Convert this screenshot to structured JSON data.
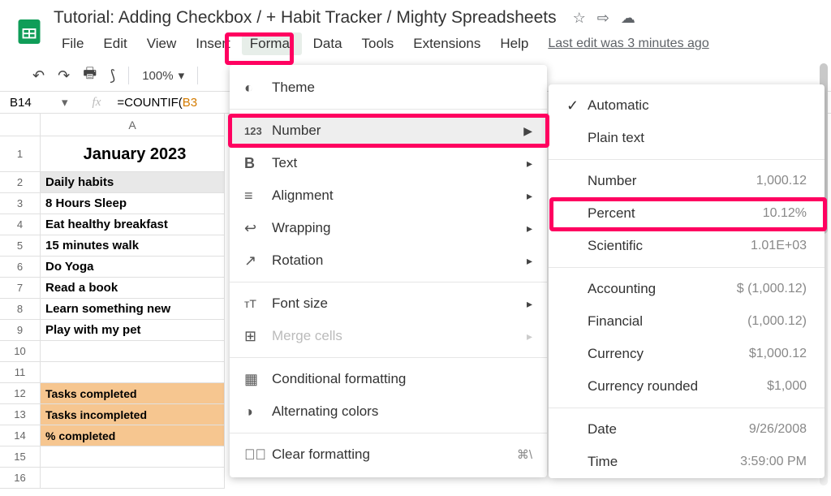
{
  "doc": {
    "title": "Tutorial: Adding Checkbox / + Habit Tracker / Mighty Spreadsheets",
    "last_edit": "Last edit was 3 minutes ago"
  },
  "menus": [
    "File",
    "Edit",
    "View",
    "Insert",
    "Format",
    "Data",
    "Tools",
    "Extensions",
    "Help"
  ],
  "toolbar": {
    "zoom": "100%"
  },
  "namebox": "B14",
  "formula": {
    "prefix": "=COUNTIF(",
    "colored": "B3"
  },
  "sheet": {
    "col_letter": "A",
    "month": "January 2023",
    "row_labels": [
      "1",
      "2",
      "3",
      "4",
      "5",
      "6",
      "7",
      "8",
      "9",
      "10",
      "11",
      "12",
      "13",
      "14",
      "15",
      "16"
    ],
    "rows": {
      "header": "Daily habits",
      "r3": "8 Hours Sleep",
      "r4": "Eat healthy breakfast",
      "r5": "15 minutes walk",
      "r6": "Do Yoga",
      "r7": "Read a book",
      "r8": "Learn something new",
      "r9": "Play with my pet",
      "r12": "Tasks completed",
      "r13": "Tasks incompleted",
      "r14": "% completed"
    }
  },
  "format_menu": {
    "theme": "Theme",
    "number": "Number",
    "text": "Text",
    "alignment": "Alignment",
    "wrapping": "Wrapping",
    "rotation": "Rotation",
    "font_size": "Font size",
    "merge_cells": "Merge cells",
    "cond_format": "Conditional formatting",
    "alt_colors": "Alternating colors",
    "clear_format": "Clear formatting",
    "clear_shortcut": "⌘\\"
  },
  "number_menu": {
    "automatic": "Automatic",
    "plain": "Plain text",
    "number": "Number",
    "number_s": "1,000.12",
    "percent": "Percent",
    "percent_s": "10.12%",
    "scientific": "Scientific",
    "scientific_s": "1.01E+03",
    "accounting": "Accounting",
    "accounting_s": "$ (1,000.12)",
    "financial": "Financial",
    "financial_s": "(1,000.12)",
    "currency": "Currency",
    "currency_s": "$1,000.12",
    "currency_r": "Currency rounded",
    "currency_r_s": "$1,000",
    "date": "Date",
    "date_s": "9/26/2008",
    "time": "Time",
    "time_s": "3:59:00 PM"
  }
}
